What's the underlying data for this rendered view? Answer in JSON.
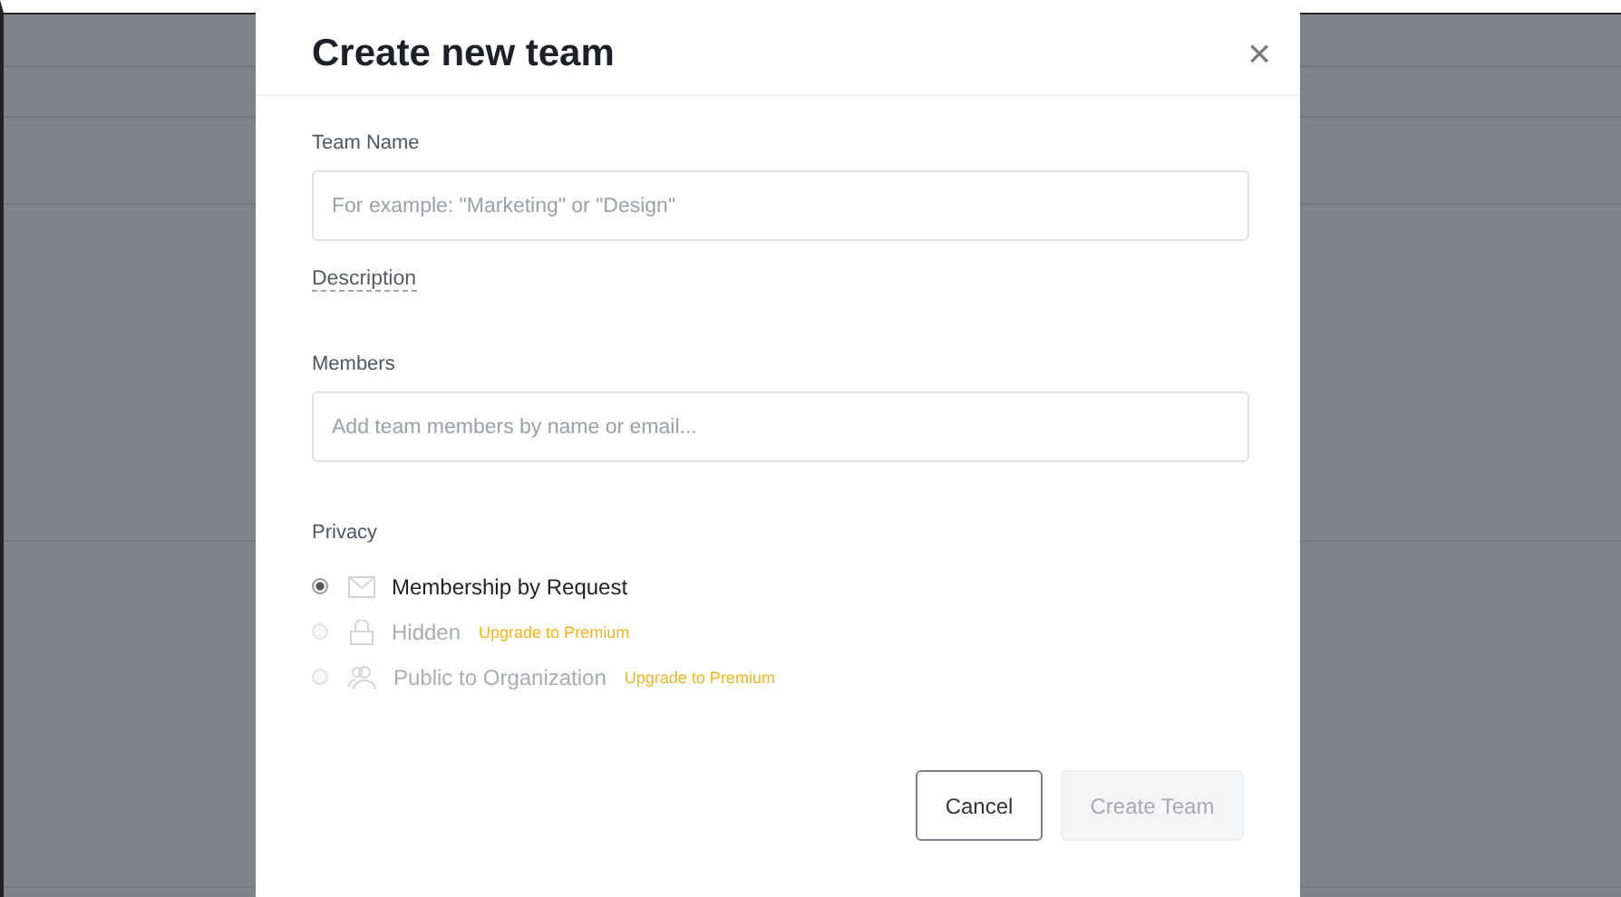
{
  "dialog": {
    "title": "Create new team",
    "close": "×",
    "fields": [
      {
        "label": "Team Name",
        "placeholder": "For example: \"Marketing\" or \"Design\""
      }
    ],
    "description_link": "Description",
    "members": {
      "label": "Members",
      "placeholder": "Add team members by name or email..."
    },
    "privacy": {
      "label": "Privacy",
      "options": [
        {
          "label": "Membership by Request",
          "selected": true,
          "disabled": false
        },
        {
          "label": "Hidden",
          "selected": false,
          "disabled": true,
          "upgrade": "Upgrade to Premium"
        },
        {
          "label": "Public to Organization",
          "selected": false,
          "disabled": true,
          "upgrade": "Upgrade to Premium"
        }
      ]
    },
    "buttons": [
      {
        "label": "Cancel",
        "disabled": false
      },
      {
        "label": "Create Team",
        "disabled": true
      }
    ]
  }
}
